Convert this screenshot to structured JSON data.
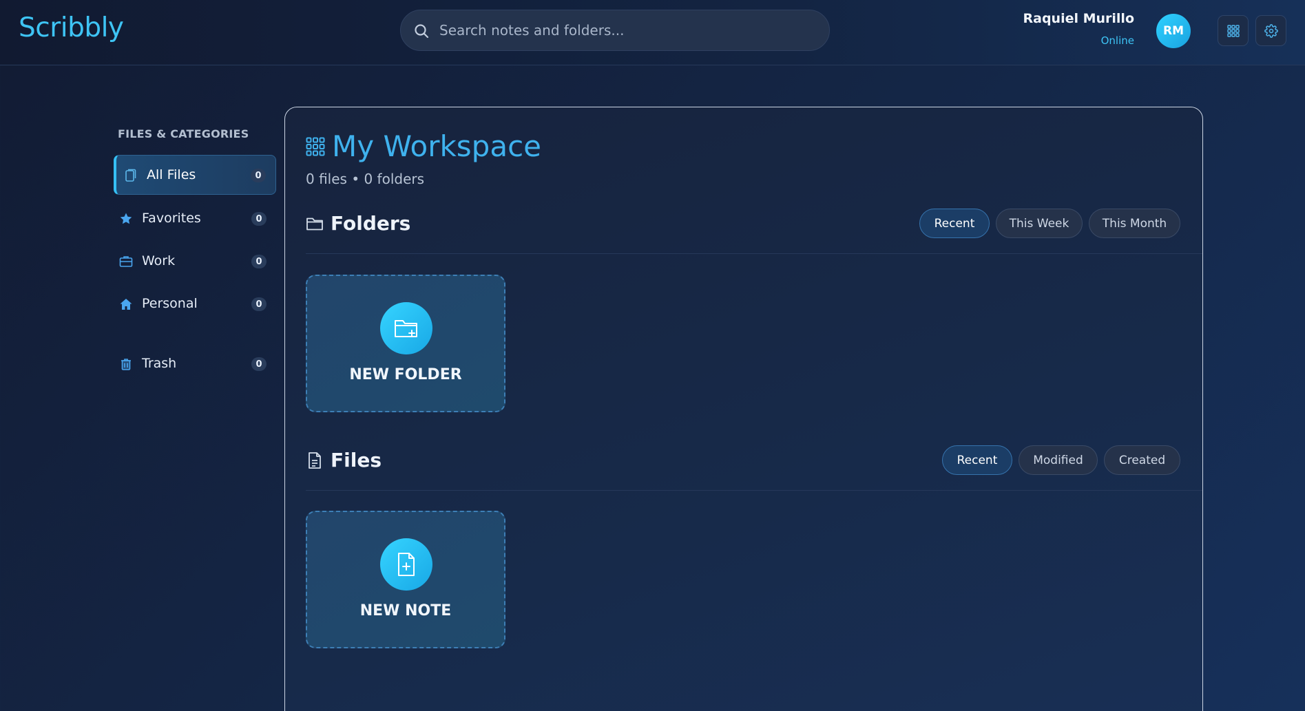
{
  "app": {
    "name": "Scribbly"
  },
  "search": {
    "placeholder": "Search notes and folders..."
  },
  "user": {
    "name": "Raquiel Murillo",
    "status": "Online",
    "initials": "RM"
  },
  "sidebar": {
    "heading": "FILES & CATEGORIES",
    "items": [
      {
        "label": "All Files",
        "count": "0",
        "icon": "file-icon",
        "active": true
      },
      {
        "label": "Favorites",
        "count": "0",
        "icon": "star-icon"
      },
      {
        "label": "Work",
        "count": "0",
        "icon": "briefcase-icon"
      },
      {
        "label": "Personal",
        "count": "0",
        "icon": "home-icon"
      },
      {
        "label": "Trash",
        "count": "0",
        "icon": "trash-icon"
      }
    ]
  },
  "workspace": {
    "title": "My Workspace",
    "meta": "0 files • 0 folders",
    "folders": {
      "title": "Folders",
      "filters": [
        "Recent",
        "This Week",
        "This Month"
      ],
      "active_filter": "Recent",
      "new_label": "NEW FOLDER"
    },
    "files": {
      "title": "Files",
      "filters": [
        "Recent",
        "Modified",
        "Created"
      ],
      "active_filter": "Recent",
      "new_label": "NEW NOTE"
    }
  },
  "colors": {
    "accent": "#3ec4f5",
    "title": "#3fb2ee",
    "background": "#142544"
  }
}
